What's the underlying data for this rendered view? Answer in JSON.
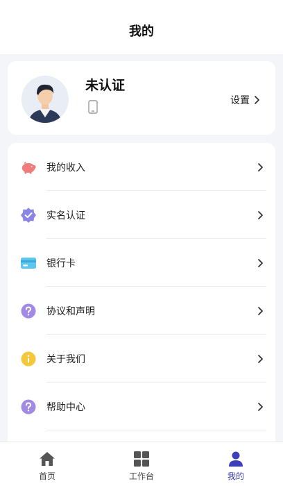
{
  "header": {
    "title": "我的"
  },
  "profile": {
    "name": "未认证",
    "settings_label": "设置"
  },
  "menu": [
    {
      "label": "我的收入",
      "icon": "piggy-bank-icon",
      "color": "#f07b7b"
    },
    {
      "label": "实名认证",
      "icon": "verified-badge-icon",
      "color": "#8b86e6"
    },
    {
      "label": "银行卡",
      "icon": "bank-card-icon",
      "color": "#5bc6f0"
    },
    {
      "label": "协议和声明",
      "icon": "question-circle-icon",
      "color": "#a389e6"
    },
    {
      "label": "关于我们",
      "icon": "info-circle-icon",
      "color": "#f3c83a"
    },
    {
      "label": "帮助中心",
      "icon": "question-circle-icon",
      "color": "#a389e6"
    }
  ],
  "tabbar": [
    {
      "label": "首页",
      "icon": "home-icon",
      "active": false
    },
    {
      "label": "工作台",
      "icon": "grid-icon",
      "active": false
    },
    {
      "label": "我的",
      "icon": "user-icon",
      "active": true
    }
  ],
  "colors": {
    "accent": "#3c3fb8",
    "background": "#f4f5f9"
  }
}
